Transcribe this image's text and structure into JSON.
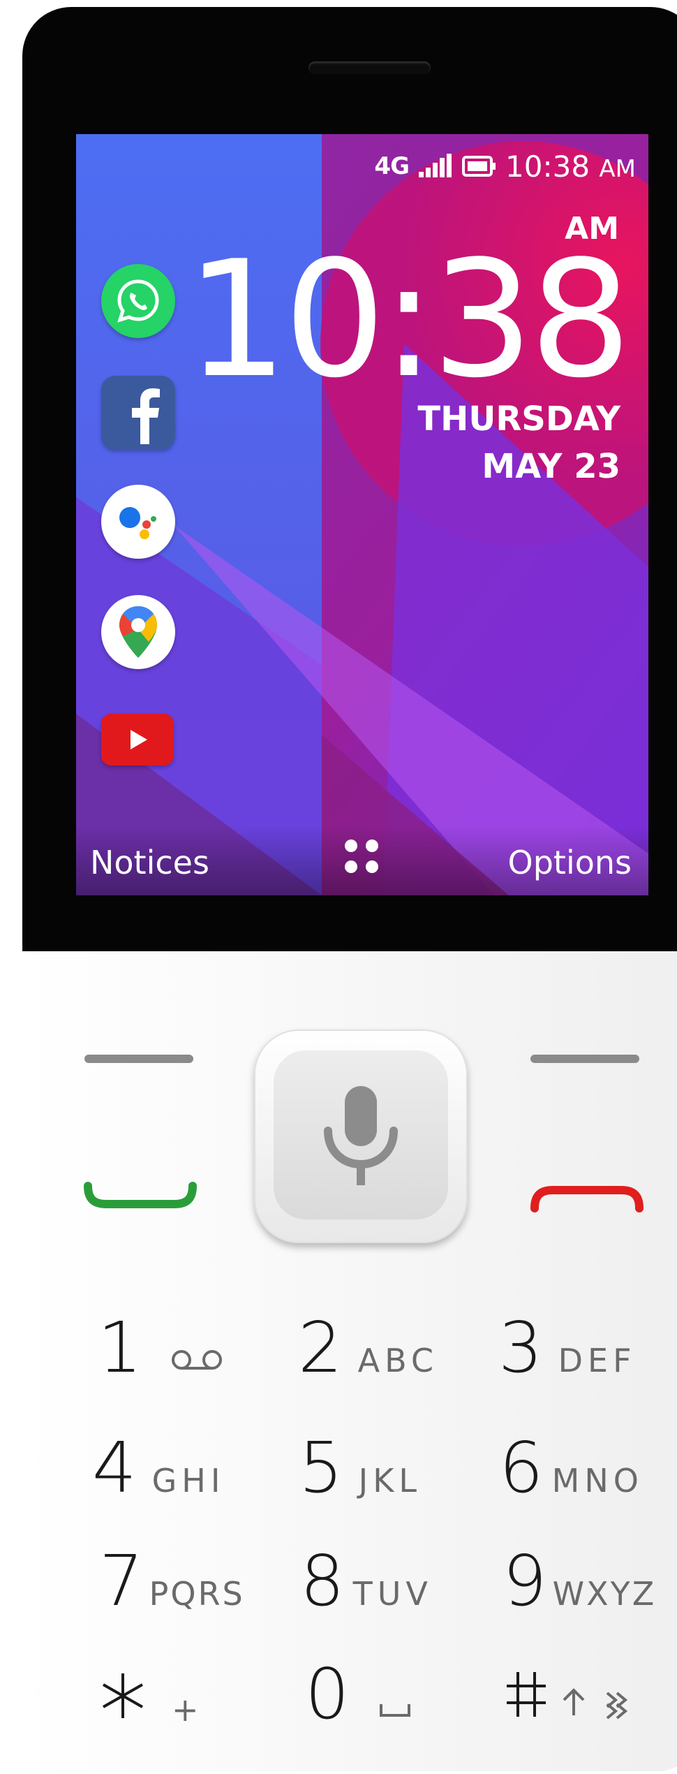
{
  "status_bar": {
    "network": "4G",
    "time": "10:38",
    "time_suffix": "AM",
    "icons": [
      "signal-icon",
      "battery-icon"
    ]
  },
  "clock": {
    "ampm": "AM",
    "time": "10:38",
    "day": "THURSDAY",
    "date": "MAY 23"
  },
  "apps": [
    {
      "name": "WhatsApp",
      "icon": "whatsapp-icon"
    },
    {
      "name": "Facebook",
      "icon": "facebook-icon"
    },
    {
      "name": "Google Assistant",
      "icon": "assistant-icon"
    },
    {
      "name": "Google Maps",
      "icon": "maps-icon"
    },
    {
      "name": "YouTube",
      "icon": "youtube-icon"
    }
  ],
  "softkeys": {
    "left": "Notices",
    "center_icon": "apps-grid-icon",
    "right": "Options"
  },
  "keypad": {
    "keys": [
      {
        "digit": "1",
        "letters": "",
        "icon": "voicemail-icon"
      },
      {
        "digit": "2",
        "letters": "ABC"
      },
      {
        "digit": "3",
        "letters": "DEF"
      },
      {
        "digit": "4",
        "letters": "GHI"
      },
      {
        "digit": "5",
        "letters": "JKL"
      },
      {
        "digit": "6",
        "letters": "MNO"
      },
      {
        "digit": "7",
        "letters": "PQRS"
      },
      {
        "digit": "8",
        "letters": "TUV"
      },
      {
        "digit": "9",
        "letters": "WXYZ"
      },
      {
        "digit": "*",
        "letters": "+"
      },
      {
        "digit": "0",
        "letters": "",
        "icon": "space-icon"
      },
      {
        "digit": "#",
        "letters": "",
        "icon": "shift-icon"
      }
    ]
  },
  "colors": {
    "call_green": "#2a9d3a",
    "end_red": "#e01e1e",
    "screen_blue": "#4a6cf0",
    "screen_magenta": "#c2186b"
  }
}
